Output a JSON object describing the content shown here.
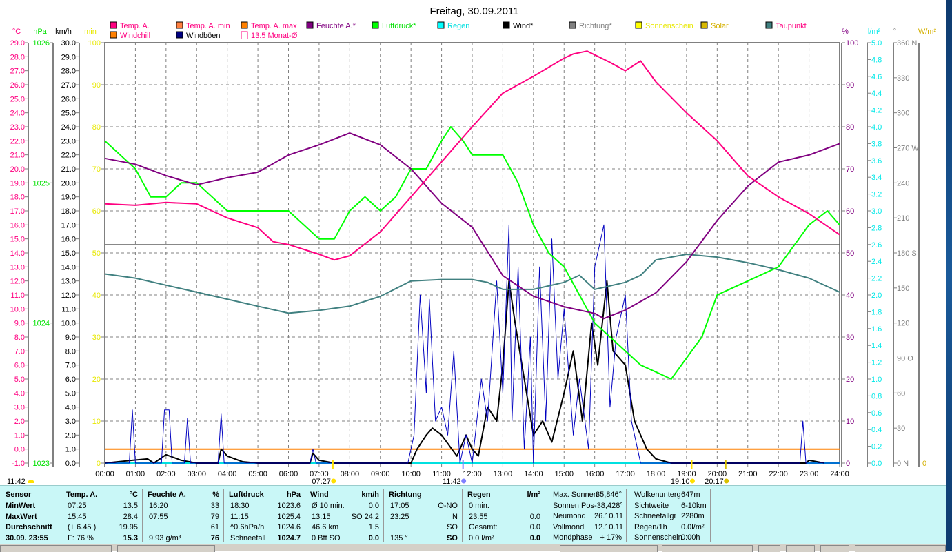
{
  "chart_data": {
    "type": "line",
    "title": "Freitag, 30.09.2011",
    "x_range": [
      0,
      24
    ],
    "x_ticks": [
      "00:00",
      "01:00",
      "02:00",
      "03:00",
      "04:00",
      "05:00",
      "06:00",
      "07:00",
      "08:00",
      "09:00",
      "10:00",
      "11:00",
      "12:00",
      "13:00",
      "14:00",
      "15:00",
      "16:00",
      "17:00",
      "18:00",
      "19:00",
      "20:00",
      "21:00",
      "22:00",
      "23:00",
      "24:00"
    ],
    "axes": {
      "temp": {
        "unit": "°C",
        "min": -1,
        "max": 29,
        "step": 1,
        "decimals": 1,
        "color": "#ff0080"
      },
      "pressure": {
        "unit": "hPa",
        "min": 1023,
        "max": 1026,
        "step": 1,
        "decimals": 0,
        "color": "#00e000"
      },
      "wind": {
        "unit": "km/h",
        "min": 0,
        "max": 30,
        "step": 1,
        "decimals": 1,
        "color": "#000000"
      },
      "minutes": {
        "unit": "min",
        "min": 0,
        "max": 100,
        "step": 10,
        "decimals": 0,
        "color": "#e8e800"
      },
      "humidity": {
        "unit": "%",
        "min": 0,
        "max": 100,
        "step": 10,
        "decimals": 0,
        "color": "#800080"
      },
      "rain": {
        "unit": "l/m²",
        "min": 0,
        "max": 5,
        "step": 0.2,
        "decimals": 1,
        "color": "#00e8e8"
      },
      "direction": {
        "unit": "°",
        "min": 0,
        "max": 360,
        "step": 30,
        "decimals": 0,
        "color": "#808080",
        "compass": {
          "0": "N",
          "90": "O",
          "180": "S",
          "270": "W",
          "360": "N"
        }
      },
      "solar": {
        "unit": "W/m²",
        "min": 0,
        "max": 0,
        "color": "#d4b000"
      }
    },
    "legend": [
      {
        "label": "Temp. A.",
        "color": "#ff0080",
        "text_color": "#ff0080"
      },
      {
        "label": "Temp. A. min",
        "color": "#ff8040",
        "text_color": "#ff0080"
      },
      {
        "label": "Temp. A. max",
        "color": "#ff8000",
        "text_color": "#ff0080"
      },
      {
        "label": "Feuchte A.*",
        "color": "#800080",
        "text_color": "#800080"
      },
      {
        "label": "Luftdruck*",
        "color": "#00ff00",
        "text_color": "#00e000"
      },
      {
        "label": "Regen",
        "color": "#00ffff",
        "text_color": "#00e0e0"
      },
      {
        "label": "Wind*",
        "color": "#000000",
        "text_color": "#000000"
      },
      {
        "label": "Richtung*",
        "color": "#808080",
        "text_color": "#808080"
      },
      {
        "label": "Sonnenschein",
        "color": "#ffff00",
        "text_color": "#e8e800"
      },
      {
        "label": "Solar",
        "color": "#d8b800",
        "text_color": "#d4b000"
      },
      {
        "label": "Taupunkt",
        "color": "#408080",
        "text_color": "#ff0080"
      },
      {
        "label": "Windchill",
        "color": "#ff8000",
        "text_color": "#ff0080"
      },
      {
        "label": "Windböen",
        "color": "#000080",
        "text_color": "#000000"
      },
      {
        "label": "13.5 Monat-Ø",
        "color": "none",
        "text_color": "#ff0080"
      }
    ],
    "series": [
      {
        "name": "Temp. A.",
        "axis": "temp",
        "color": "#ff0080",
        "width": 2,
        "x": [
          0,
          1,
          2,
          3,
          3.5,
          4,
          5,
          5.5,
          6,
          7,
          7.5,
          8,
          9,
          10,
          11,
          12,
          12.5,
          13,
          14,
          15,
          15.3,
          15.75,
          16.5,
          17,
          17.5,
          18,
          19,
          20,
          21,
          22,
          23,
          24
        ],
        "y": [
          17.5,
          17.4,
          17.6,
          17.5,
          17.0,
          16.5,
          15.8,
          14.8,
          14.6,
          13.9,
          13.5,
          13.8,
          15.5,
          18.0,
          20.5,
          23.0,
          24.2,
          25.4,
          26.6,
          27.9,
          28.2,
          28.4,
          27.6,
          27.0,
          27.7,
          26.2,
          24.0,
          22.0,
          19.5,
          18.0,
          16.8,
          15.3
        ]
      },
      {
        "name": "Feuchte A.*",
        "axis": "humidity",
        "color": "#800080",
        "width": 2,
        "x": [
          0,
          1,
          2,
          3,
          4,
          5,
          6,
          7,
          8,
          9,
          10,
          11,
          12,
          13,
          14,
          15,
          16,
          16.3,
          17,
          18,
          19,
          20,
          21,
          22,
          23,
          24
        ],
        "y": [
          72.5,
          71.1,
          68.4,
          66.2,
          67.9,
          69.2,
          73.3,
          75.7,
          78.5,
          75.7,
          70.0,
          61.8,
          56.1,
          44.6,
          39.7,
          37.2,
          35.6,
          34.4,
          36.4,
          40.5,
          47.9,
          57.7,
          65.9,
          71.6,
          73.3,
          76
        ]
      },
      {
        "name": "Luftdruck*",
        "axis": "pressure",
        "color": "#00ff00",
        "width": 2,
        "x": [
          0,
          0.5,
          1,
          1.5,
          2,
          2.5,
          3,
          3.5,
          4,
          4.5,
          5,
          6,
          6.5,
          7,
          7.5,
          8,
          8.5,
          9,
          9.5,
          10,
          10.5,
          11,
          11.3,
          11.7,
          12,
          12.5,
          13,
          13.5,
          14,
          14.5,
          15,
          15.5,
          16,
          16.5,
          17,
          17.5,
          18,
          18.5,
          19,
          19.5,
          20,
          20.5,
          21,
          21.5,
          22,
          22.5,
          23,
          23.6,
          24
        ],
        "y": [
          1025.3,
          1025.2,
          1025.1,
          1024.9,
          1024.9,
          1025.0,
          1025.0,
          1024.9,
          1024.8,
          1024.8,
          1024.8,
          1024.8,
          1024.7,
          1024.6,
          1024.6,
          1024.8,
          1024.9,
          1024.8,
          1024.9,
          1025.1,
          1025.1,
          1025.3,
          1025.4,
          1025.3,
          1025.2,
          1025.2,
          1025.2,
          1025.0,
          1024.7,
          1024.5,
          1024.4,
          1024.2,
          1024.0,
          1023.9,
          1023.8,
          1023.7,
          1023.65,
          1023.6,
          1023.75,
          1023.9,
          1024.2,
          1024.25,
          1024.3,
          1024.35,
          1024.4,
          1024.55,
          1024.7,
          1024.8,
          1024.7
        ]
      },
      {
        "name": "Taupunkt",
        "axis": "temp",
        "color": "#408080",
        "width": 2,
        "x": [
          0,
          1,
          2,
          3,
          4,
          5,
          6,
          7,
          8,
          9,
          10,
          11,
          12,
          12.5,
          13,
          14,
          15,
          15.5,
          16,
          17,
          17.5,
          18,
          19,
          20,
          21,
          22,
          23,
          24
        ],
        "y": [
          12.5,
          12.2,
          11.7,
          11.2,
          10.7,
          10.2,
          9.7,
          9.9,
          10.2,
          10.9,
          12.0,
          12.1,
          12.1,
          11.9,
          11.4,
          11.4,
          11.9,
          12.4,
          11.4,
          11.9,
          12.4,
          13.5,
          13.9,
          13.7,
          13.3,
          12.8,
          12.2,
          11.2
        ]
      },
      {
        "name": "Windböen",
        "axis": "wind",
        "color": "#0000c0",
        "width": 1,
        "x": [
          0,
          0.8,
          0.9,
          1.0,
          1.85,
          1.95,
          2.1,
          2.2,
          2.6,
          2.7,
          2.8,
          3.7,
          3.8,
          3.9,
          6.7,
          6.8,
          6.9,
          9.9,
          10.1,
          10.3,
          10.5,
          10.6,
          10.8,
          11,
          11.2,
          11.4,
          11.6,
          11.8,
          12,
          12.3,
          12.5,
          12.8,
          13,
          13.2,
          13.3,
          13.5,
          13.7,
          13.9,
          14,
          14.2,
          14.4,
          14.6,
          14.8,
          15,
          15.3,
          15.5,
          15.8,
          16.0,
          16.3,
          16.5,
          16.7,
          17,
          17.2,
          17.5,
          18,
          22.7,
          22.8,
          22.9,
          24
        ],
        "y": [
          0,
          0,
          3.8,
          0,
          0,
          3.8,
          3.8,
          0,
          0,
          3.2,
          0,
          0,
          3.5,
          0,
          0,
          1.0,
          0,
          0,
          2,
          12,
          5,
          11.7,
          3,
          4,
          2,
          8,
          0,
          2,
          0,
          6,
          3,
          13,
          5,
          17,
          3,
          14,
          1,
          9,
          0,
          14,
          3,
          16,
          6,
          11,
          2,
          6,
          1,
          14,
          17,
          4,
          9,
          12,
          3,
          0,
          0,
          0,
          3,
          0,
          0
        ]
      },
      {
        "name": "Wind*",
        "axis": "wind",
        "color": "#000000",
        "width": 2,
        "x": [
          0,
          0.9,
          1.4,
          1.6,
          2,
          2.5,
          3,
          3.7,
          3.8,
          4,
          4.5,
          5,
          6.7,
          6.8,
          7,
          7.5,
          10,
          10.2,
          10.5,
          10.7,
          11,
          11.5,
          11.8,
          12,
          12.2,
          12.5,
          12.8,
          13,
          13.2,
          13.4,
          13.7,
          14,
          14.3,
          14.6,
          15,
          15.3,
          15.6,
          15.9,
          16.1,
          16.4,
          16.6,
          17,
          17.3,
          17.7,
          18,
          18.5,
          19,
          22.9,
          23,
          23.5
        ],
        "y": [
          0,
          0.2,
          0.3,
          0,
          0.6,
          0.2,
          0,
          0,
          1.0,
          0.5,
          0.1,
          0,
          0,
          0.7,
          0.2,
          0,
          0,
          1,
          2,
          2.5,
          2,
          0.5,
          2,
          1,
          0.5,
          4,
          3,
          7,
          13,
          10,
          6,
          2,
          3,
          1.5,
          5,
          8,
          3,
          10,
          7,
          13,
          8,
          7,
          3,
          1,
          0.3,
          0,
          0,
          0,
          0.2,
          0
        ]
      },
      {
        "name": "Regen",
        "axis": "rain",
        "color": "#00e0e0",
        "width": 2,
        "x": [
          0,
          24
        ],
        "y": [
          0,
          0
        ]
      },
      {
        "name": "Windchill",
        "axis": "temp",
        "color": "#ff8000",
        "width": 2,
        "x": [
          0,
          24
        ],
        "y": [
          0,
          0
        ]
      },
      {
        "name": "13.5 Monat-Ø",
        "axis": "temp",
        "color": "#606060",
        "width": 1,
        "x": [
          0,
          24
        ],
        "y": [
          14.6,
          14.6
        ]
      }
    ],
    "time_markers": [
      {
        "label": "07:27",
        "time": 7.45,
        "icon": "sunrise",
        "color": "#ffe000"
      },
      {
        "label": "11:42",
        "time": 11.7,
        "icon": "noon",
        "color": "#8080ff"
      },
      {
        "label": "19:10",
        "time": 19.17,
        "icon": "sunset",
        "color": "#ffe000"
      },
      {
        "label": "20:17",
        "time": 20.28,
        "icon": "moonrise",
        "color": "#d8c000"
      }
    ],
    "corner_time": "11:42"
  },
  "table": {
    "columns": [
      {
        "header": [
          "Sensor",
          ""
        ],
        "rows": [
          [
            "MinWert",
            ""
          ],
          [
            "MaxWert",
            ""
          ],
          [
            "Durchschnitt",
            ""
          ],
          [
            "30.09. 23:55",
            ""
          ]
        ],
        "bold_left": true
      },
      {
        "header": [
          "Temp. A.",
          "°C"
        ],
        "rows": [
          [
            "07:25",
            "13.5"
          ],
          [
            "15:45",
            "28.4"
          ],
          [
            "(+ 6.45 )",
            "19.95"
          ],
          [
            "F: 76 %",
            "15.3"
          ]
        ]
      },
      {
        "header": [
          "Feuchte A.",
          "%"
        ],
        "rows": [
          [
            "16:20",
            "33"
          ],
          [
            "07:55",
            "79"
          ],
          [
            "",
            "61"
          ],
          [
            "9.93 g/m³",
            "76"
          ]
        ]
      },
      {
        "header": [
          "Luftdruck",
          "hPa"
        ],
        "rows": [
          [
            "18:30",
            "1023.6"
          ],
          [
            "11:15",
            "1025.4"
          ],
          [
            "^0.6hPa/h",
            "1024.6"
          ],
          [
            "Schneefall",
            "1024.7"
          ]
        ]
      },
      {
        "header": [
          "Wind",
          "km/h"
        ],
        "rows": [
          [
            "Ø 10 min.",
            "0.0"
          ],
          [
            "13:15",
            "SO 24.2"
          ],
          [
            "46.6 km",
            "1.5"
          ],
          [
            "0 Bft SO",
            "0.0"
          ]
        ]
      },
      {
        "header": [
          "Richtung",
          ""
        ],
        "rows": [
          [
            "17:05",
            "O-NO"
          ],
          [
            "23:25",
            "N"
          ],
          [
            "",
            "SO"
          ],
          [
            "135 °",
            "SO"
          ]
        ]
      },
      {
        "header": [
          "Regen",
          "l/m²"
        ],
        "rows": [
          [
            "0 min.",
            ""
          ],
          [
            "23:55",
            "0.0"
          ],
          [
            "Gesamt:",
            "0.0"
          ],
          [
            "0.0 l/m²",
            "0.0"
          ]
        ]
      }
    ],
    "info": [
      [
        [
          "Max. Sonnen",
          "35,846°"
        ],
        [
          "Sonnen Pos",
          "-38,428°"
        ],
        [
          "Neumond",
          "26.10.11"
        ],
        [
          "Vollmond",
          "12.10.11"
        ],
        [
          "Mondphase",
          "+ 17%"
        ]
      ],
      [
        [
          "Wolkenunterg",
          "647m"
        ],
        [
          "Sichtweite",
          "6-10km"
        ],
        [
          "Schneefallgr",
          "2280m"
        ],
        [
          "Regen/1h",
          "0.0l/m²"
        ],
        [
          "Sonnenschein",
          "0:00h"
        ]
      ]
    ]
  }
}
